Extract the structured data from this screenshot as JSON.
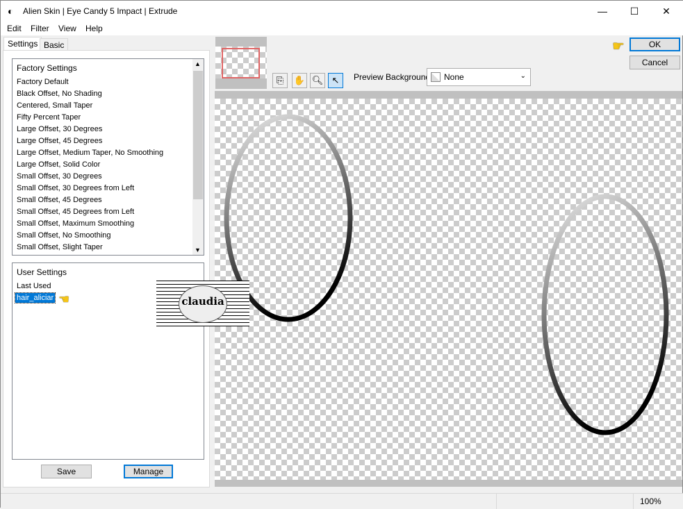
{
  "window": {
    "title": "Alien Skin | Eye Candy 5 Impact | Extrude",
    "minimize": "—",
    "maximize": "☐",
    "close": "✕"
  },
  "menu": [
    "Edit",
    "Filter",
    "View",
    "Help"
  ],
  "tabs": [
    "Settings",
    "Basic"
  ],
  "factory": {
    "header": "Factory Settings",
    "items": [
      "Factory Default",
      "Black Offset, No Shading",
      "Centered, Small Taper",
      "Fifty Percent Taper",
      "Large Offset, 30 Degrees",
      "Large Offset, 45 Degrees",
      "Large Offset, Medium Taper, No Smoothing",
      "Large Offset, Solid Color",
      "Small Offset, 30 Degrees",
      "Small Offset, 30 Degrees from Left",
      "Small Offset, 45 Degrees",
      "Small Offset, 45 Degrees from Left",
      "Small Offset, Maximum Smoothing",
      "Small Offset, No Smoothing",
      "Small Offset, Slight Taper"
    ]
  },
  "user": {
    "header": "User Settings",
    "items": [
      "Last Used",
      "hair_aliciar"
    ],
    "selected": "hair_aliciar"
  },
  "buttons": {
    "save": "Save",
    "manage": "Manage",
    "ok": "OK",
    "cancel": "Cancel"
  },
  "toolbar": {
    "preview_bg_label": "Preview Background:",
    "preview_bg_value": "None"
  },
  "watermark": "claudia",
  "status": {
    "zoom": "100%"
  },
  "colors": {
    "selection": "#0078d7",
    "thumb_frame": "#e06666",
    "pointer_hand": "#f5c518"
  }
}
